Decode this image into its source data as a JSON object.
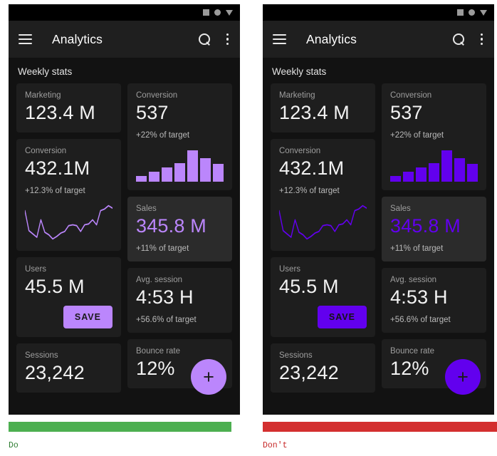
{
  "accents": {
    "do": "#BB86FC",
    "dont": "#6200EE"
  },
  "captions": {
    "do": {
      "label": "Do",
      "bar_color": "#4CAF50",
      "text_color": "#2E7D32"
    },
    "dont": {
      "label": "Don't",
      "bar_color": "#D32F2F",
      "text_color": "#C62828"
    }
  },
  "statusbar": {
    "icons": [
      "square-icon",
      "circle-icon",
      "triangle-down-icon"
    ]
  },
  "appbar": {
    "menu_icon": "hamburger-menu-icon",
    "title": "Analytics",
    "search_icon": "search-icon",
    "overflow_icon": "more-vert-icon"
  },
  "section": {
    "title": "Weekly stats"
  },
  "cards": {
    "marketing": {
      "label": "Marketing",
      "value": "123.4 M"
    },
    "conversion_left": {
      "label": "Conversion",
      "value": "432.1M",
      "sub": "+12.3% of target"
    },
    "users": {
      "label": "Users",
      "value": "45.5 M",
      "button": "SAVE"
    },
    "sessions": {
      "label": "Sessions",
      "value": "23,242"
    },
    "conversion_right": {
      "label": "Conversion",
      "value": "537",
      "sub": "+22% of target"
    },
    "sales": {
      "label": "Sales",
      "value": "345.8 M",
      "sub": "+11% of target"
    },
    "avg_session": {
      "label": "Avg. session",
      "value": "4:53 H",
      "sub": "+56.6% of target"
    },
    "bounce_rate": {
      "label": "Bounce rate",
      "value": "12%"
    }
  },
  "fab": {
    "icon": "plus-icon",
    "label": "+"
  },
  "chart_data": [
    {
      "type": "bar",
      "title": "Conversion weekly bars",
      "categories": [
        "1",
        "2",
        "3",
        "4",
        "5",
        "6",
        "7"
      ],
      "values": [
        8,
        14,
        20,
        26,
        44,
        33,
        25
      ],
      "ylim": [
        0,
        46
      ],
      "xlabel": "",
      "ylabel": "",
      "grid": false,
      "legend": "none"
    },
    {
      "type": "line",
      "title": "Conversion trend sparkline",
      "x": [
        0,
        1,
        2,
        3,
        4,
        5,
        6,
        7,
        8,
        9,
        10,
        11,
        12,
        13,
        14,
        15,
        16,
        17,
        18,
        19,
        20,
        21,
        22
      ],
      "values": [
        38,
        14,
        10,
        6,
        27,
        12,
        9,
        4,
        7,
        11,
        13,
        20,
        21,
        20,
        13,
        21,
        22,
        27,
        21,
        38,
        40,
        44,
        41
      ],
      "ylim": [
        0,
        48
      ],
      "xlabel": "",
      "ylabel": "",
      "grid": false,
      "legend": "none"
    }
  ]
}
